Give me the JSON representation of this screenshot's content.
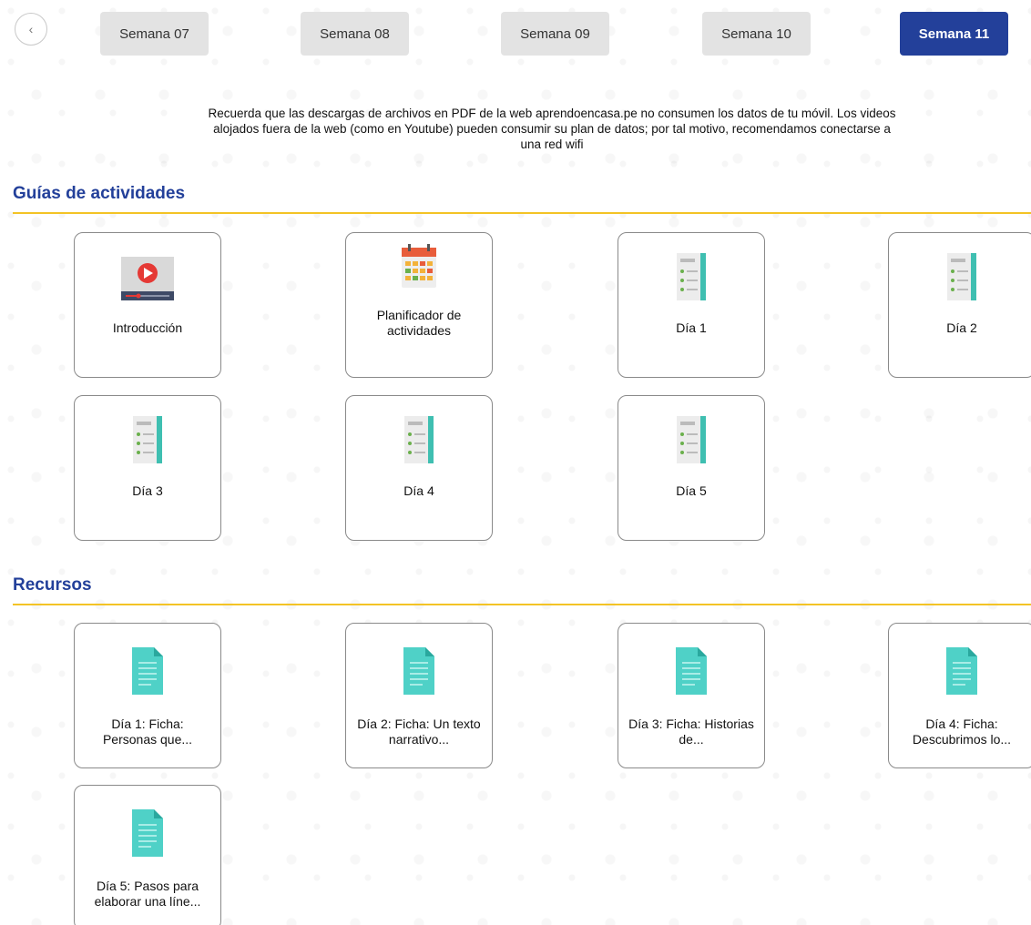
{
  "nav": {
    "prev_icon": "chevron-left-icon",
    "weeks": [
      {
        "label": "Semana 07",
        "active": false
      },
      {
        "label": "Semana 08",
        "active": false
      },
      {
        "label": "Semana 09",
        "active": false
      },
      {
        "label": "Semana 10",
        "active": false
      },
      {
        "label": "Semana 11",
        "active": true
      }
    ],
    "active_color": "#23409a"
  },
  "notice": "Recuerda que las descargas de archivos en PDF de la web aprendoencasa.pe no consumen los datos de tu móvil. Los videos alojados fuera de la web (como en Youtube) pueden consumir su plan de datos; por tal motivo, recomendamos conectarse a una red wifi",
  "guides": {
    "title": "Guías de actividades",
    "items": [
      {
        "label": "Introducción",
        "icon": "video-player-icon"
      },
      {
        "label": "Planificador de actividades",
        "icon": "calendar-icon"
      },
      {
        "label": "Día 1",
        "icon": "document-list-icon"
      },
      {
        "label": "Día 2",
        "icon": "document-list-icon"
      },
      {
        "label": "Día 3",
        "icon": "document-list-icon"
      },
      {
        "label": "Día 4",
        "icon": "document-list-icon"
      },
      {
        "label": "Día 5",
        "icon": "document-list-icon"
      }
    ]
  },
  "resources": {
    "title": "Recursos",
    "items": [
      {
        "label": "Día 1: Ficha: Personas que...",
        "icon": "file-icon"
      },
      {
        "label": "Día 2: Ficha: Un texto narrativo...",
        "icon": "file-icon"
      },
      {
        "label": "Día 3: Ficha: Historias de...",
        "icon": "file-icon"
      },
      {
        "label": "Día 4: Ficha: Descubrimos lo...",
        "icon": "file-icon"
      },
      {
        "label": "Día 5: Pasos para elaborar una líne...",
        "icon": "file-icon"
      }
    ]
  },
  "colors": {
    "title": "#23409a",
    "rule": "#f3c325"
  }
}
